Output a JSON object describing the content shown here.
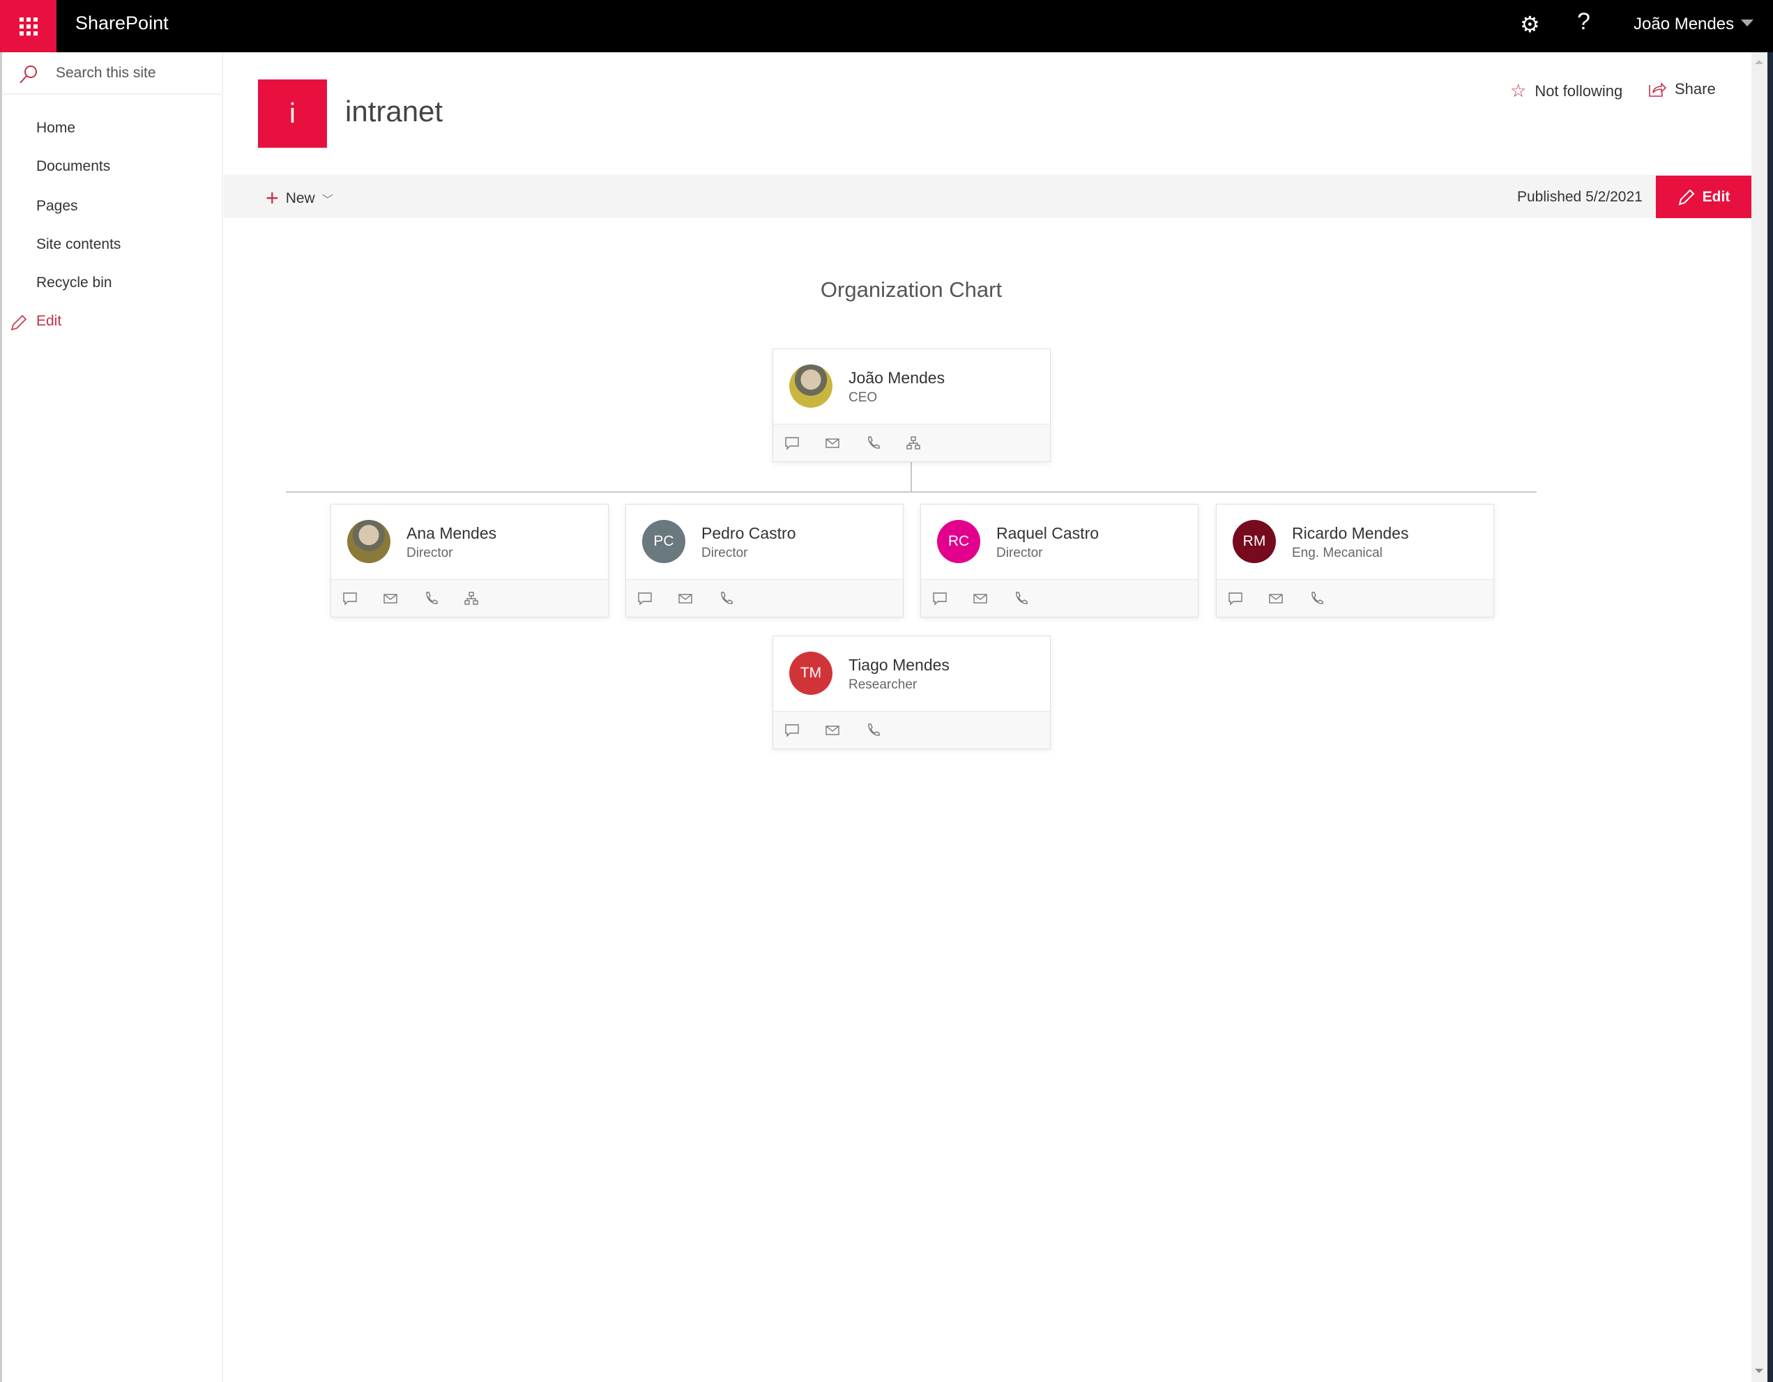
{
  "topbar": {
    "app_name": "SharePoint",
    "user_name": "João Mendes",
    "icons": [
      "waffle-icon",
      "gear-icon",
      "help-icon"
    ],
    "accent": "#e8103f"
  },
  "sidebar": {
    "search_placeholder": "Search this site",
    "items": [
      {
        "label": "Home"
      },
      {
        "label": "Documents"
      },
      {
        "label": "Pages"
      },
      {
        "label": "Site contents"
      },
      {
        "label": "Recycle bin"
      }
    ],
    "edit_label": "Edit"
  },
  "site": {
    "logo_letter": "i",
    "name": "intranet",
    "follow_label": "Not following",
    "share_label": "Share"
  },
  "commandbar": {
    "new_label": "New",
    "published": "Published 5/2/2021",
    "edit_label": "Edit"
  },
  "orgchart": {
    "title": "Organization Chart",
    "people": [
      {
        "name": "João Mendes",
        "title": "CEO",
        "initials": "",
        "photo": true,
        "color": "#c9b640",
        "org_icon": true
      },
      {
        "name": "Ana Mendes",
        "title": "Director",
        "initials": "",
        "photo": true,
        "color": "#8a7a3a",
        "org_icon": true
      },
      {
        "name": "Pedro Castro",
        "title": "Director",
        "initials": "PC",
        "photo": false,
        "color": "#69797e",
        "org_icon": false
      },
      {
        "name": "Raquel Castro",
        "title": "Director",
        "initials": "RC",
        "photo": false,
        "color": "#e3008c",
        "org_icon": false
      },
      {
        "name": "Ricardo Mendes",
        "title": "Eng. Mecanical",
        "initials": "RM",
        "photo": false,
        "color": "#750b1c",
        "org_icon": false
      },
      {
        "name": "Tiago Mendes",
        "title": "Researcher",
        "initials": "TM",
        "photo": false,
        "color": "#d13438",
        "org_icon": false
      }
    ]
  }
}
